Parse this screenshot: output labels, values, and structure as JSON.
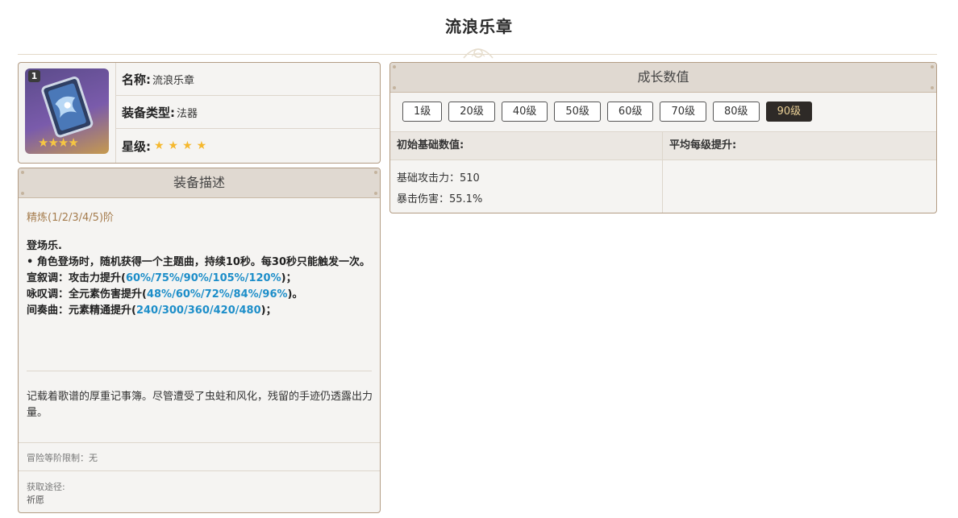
{
  "page": {
    "title": "流浪乐章"
  },
  "weapon": {
    "refine_badge": "1",
    "thumb_stars": "★★★★",
    "name_key": "名称:",
    "name_val": "流浪乐章",
    "type_key": "装备类型:",
    "type_val": "法器",
    "rarity_key": "星级:",
    "rarity_stars": "★★★★",
    "rarity_count": 4
  },
  "description": {
    "header": "装备描述",
    "refine_label": "精炼(1/2/3/4/5)阶",
    "passive_title": "登场乐.",
    "passive_line1": "• 角色登场时，随机获得一个主题曲，持续10秒。每30秒只能触发一次。",
    "recit_prefix": "宣叙调：攻击力提升(",
    "recit_values": "60%/75%/90%/105%/120%",
    "recit_suffix": ")；",
    "aria_prefix": "咏叹调：全元素伤害提升(",
    "aria_values": "48%/60%/72%/84%/96%",
    "aria_suffix": ")。",
    "inter_prefix": "间奏曲：元素精通提升(",
    "inter_values": "240/300/360/420/480",
    "inter_suffix": ")；",
    "lore": "记载着歌谱的厚重记事簿。尽管遭受了虫蛀和风化，残留的手迹仍透露出力量。",
    "limit": "冒险等阶限制：无",
    "source_label": "获取途径:",
    "source_value": "祈愿"
  },
  "growth": {
    "header": "成长数值",
    "levels": [
      "1级",
      "20级",
      "40级",
      "50级",
      "60级",
      "70级",
      "80级",
      "90级"
    ],
    "selected_level": "90级",
    "base_head": "初始基础数值:",
    "avg_head": "平均每级提升:",
    "base_atk": "基础攻击力：510",
    "crit_dmg": "暴击伤害：55.1%"
  },
  "colors": {
    "accent_blue": "#1d8ec9",
    "refine_gold": "#a57c4d",
    "star_gold": "#f5b82e",
    "header_bg": "#e0d9d1",
    "active_btn_bg": "#2e2a27"
  }
}
